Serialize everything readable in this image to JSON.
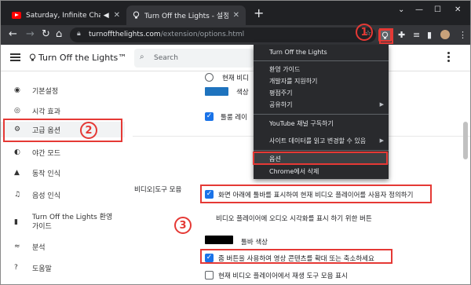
{
  "browser": {
    "tabs": [
      {
        "title": "Saturday, Infinite Challenge",
        "icon": "youtube-icon",
        "audio": true
      },
      {
        "title": "Turn Off the Lights - 설정",
        "icon": "lightbulb-icon",
        "active": true
      }
    ],
    "url_host": "turnoffthelights.com",
    "url_path": "/extension/options.html"
  },
  "app": {
    "title": "Turn Off the Lights™",
    "search_placeholder": "Search"
  },
  "sidebar": {
    "items": [
      {
        "label": "기본설정",
        "icon": "palette-icon"
      },
      {
        "label": "시각 효과",
        "icon": "eye-icon"
      },
      {
        "label": "고급 옵션",
        "icon": "tune-icon",
        "active": true
      },
      {
        "label": "야간 모드",
        "icon": "night-mode-icon"
      },
      {
        "label": "동작 인식",
        "icon": "motion-icon"
      },
      {
        "label": "음성 인식",
        "icon": "microphone-icon"
      },
      {
        "label": "Turn Off the Lights 환영 가이드",
        "icon": "bookmark-icon"
      },
      {
        "label": "분석",
        "icon": "analytics-icon"
      },
      {
        "label": "도움말",
        "icon": "help-icon"
      }
    ]
  },
  "main": {
    "top_radio_label": "현재 비디",
    "color_label": "색상",
    "tool_layer_label": "툴룸 레이",
    "section_title": "비디오|도구 모음",
    "opt1_label": "화면 아래에 툴바를 표시하여 현재 비디오 플레이어를 사용자 정의하기",
    "opt1_desc": "비디오 플레이어에 오디오 시각화를 표시 하기 위한 버튼",
    "toolbar_color_label": "툴바 색상",
    "opt2_label": "줌 버튼을 사용하여 영상 콘텐츠를 확대 또는 축소하세요",
    "opt3_label": "현재 비디오 플레이어에서 재생 도구 모음 표시",
    "accent_color": "#1a73e8",
    "swatch_color": "#1e73be",
    "toolbar_color": "#000000"
  },
  "menu": {
    "header": "Turn Off the Lights",
    "group1": [
      "환영 가이드",
      "개발자를 지원하기",
      "평점주기",
      "공유하기"
    ],
    "group2": [
      "YouTube 채널 구독하기",
      "사이트 데이터를 읽고 변경할 수 있음"
    ],
    "options": "옵션",
    "remove": "Chrome에서 삭제"
  },
  "annotations": [
    "1",
    "2",
    "3"
  ]
}
